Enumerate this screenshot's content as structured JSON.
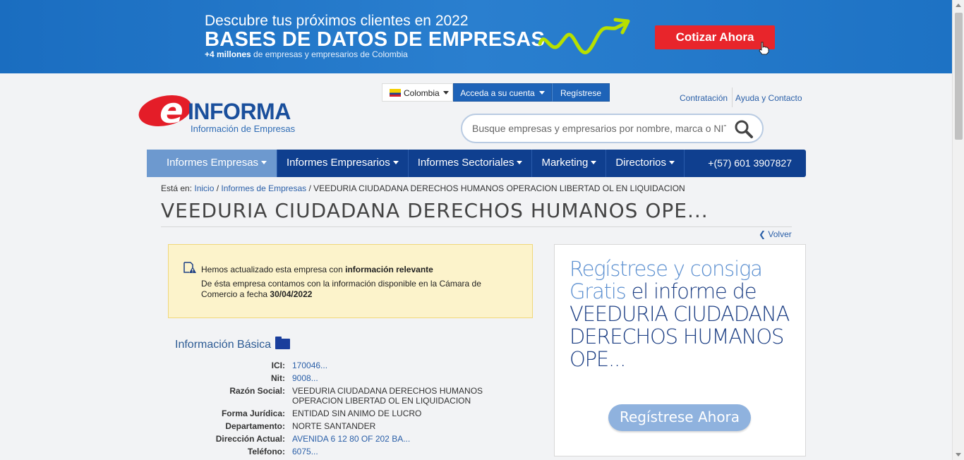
{
  "banner": {
    "line1": "Descubre tus próximos clientes en 2022",
    "line2": "BASES DE DATOS DE EMPRESAS",
    "line3_bold": "+4 millones",
    "line3_rest": " de empresas y empresarios de Colombia",
    "cta": "Cotizar Ahora",
    "colors": {
      "background": "#1a6dc0",
      "cta": "#e8252b",
      "arrow": "#b7e000"
    }
  },
  "logo": {
    "brand": "INFORMA",
    "e": "e",
    "tagline": "Información de Empresas"
  },
  "topbar": {
    "country": "Colombia",
    "account": "Acceda a su cuenta",
    "register": "Regístrese",
    "links": [
      "Contratación",
      "Ayuda y Contacto"
    ]
  },
  "search": {
    "placeholder": "Busque empresas y empresarios por nombre, marca o NIT",
    "icon": "search-icon"
  },
  "nav": {
    "items": [
      "Informes Empresas",
      "Informes Empresarios",
      "Informes Sectoriales",
      "Marketing",
      "Directorios"
    ],
    "phone": "+(57) 601 3907827",
    "colors": {
      "bar": "#0f3f8f",
      "active": "#6d99cf"
    }
  },
  "breadcrumb": {
    "prefix": "Está en:",
    "home": "Inicio",
    "section": "Informes de Empresas",
    "current": "VEEDURIA CIUDADANA DERECHOS HUMANOS OPERACION LIBERTAD OL EN LIQUIDACION"
  },
  "page_title": "VEEDURIA CIUDADANA DERECHOS HUMANOS OPE...",
  "back_label": "Volver",
  "notice": {
    "line1_text": "Hemos actualizado esta empresa con ",
    "line1_bold": "información relevante",
    "line2_text": "De ésta empresa contamos con la información disponible en la Cámara de Comercio a fecha ",
    "line2_bold": "30/04/2022"
  },
  "info": {
    "heading": "Información Básica",
    "rows": [
      {
        "label": "ICI:",
        "value": "170046..."
      },
      {
        "label": "Nit:",
        "value": "9008..."
      },
      {
        "label": "Razón Social:",
        "value": "VEEDURIA CIUDADANA DERECHOS HUMANOS OPERACION LIBERTAD OL EN LIQUIDACION"
      },
      {
        "label": "Forma Jurídica:",
        "value": "ENTIDAD SIN ANIMO DE LUCRO"
      },
      {
        "label": "Departamento:",
        "value": "NORTE SANTANDER"
      },
      {
        "label": "Dirección Actual:",
        "value": "AVENIDA 6 12 80 OF 202 BA..."
      },
      {
        "label": "Teléfono:",
        "value": "6075..."
      }
    ]
  },
  "sidebox": {
    "light": "Regístrese y consiga Gratis",
    "dark": " el informe de VEEDURIA CIUDADANA DERECHOS HUMANOS OPE...",
    "button": "Regístrese Ahora"
  }
}
